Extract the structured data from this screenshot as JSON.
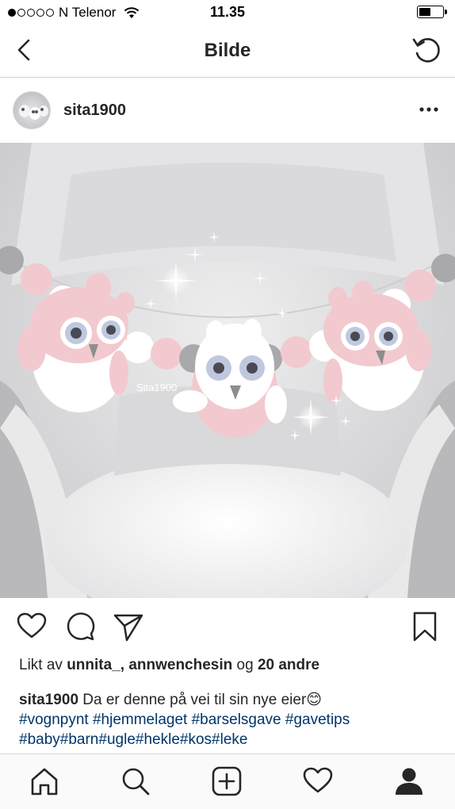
{
  "status_bar": {
    "carrier": "N Telenor",
    "time": "11.35",
    "signal_bars_filled": 1,
    "signal_bars_total": 5,
    "battery_level": 0.5
  },
  "nav": {
    "title": "Bilde",
    "back_icon": "chevron-left-icon",
    "refresh_icon": "refresh-icon"
  },
  "post": {
    "username": "sita1900",
    "more_icon": "more-horizontal-icon",
    "image_watermark": "Sita1900",
    "likes": {
      "prefix": "Likt av ",
      "user1": "unnita_",
      "separator": ", ",
      "user2": "annwenchesin",
      "middle": " og ",
      "others": "20 andre"
    },
    "caption": {
      "user": "sita1900",
      "text": " Da er denne på vei til sin nye eier😊",
      "hashtags": [
        "#vognpynt",
        "#hjemmelaget",
        "#barselsgave",
        "#gavetips",
        "#baby",
        "#barn",
        "#ugle",
        "#hekle",
        "#kos",
        "#leke"
      ]
    }
  },
  "actions": {
    "like_icon": "heart-icon",
    "comment_icon": "comment-icon",
    "share_icon": "send-icon",
    "save_icon": "bookmark-icon"
  },
  "tab_bar": {
    "items": [
      "home-icon",
      "search-icon",
      "add-icon",
      "activity-heart-icon",
      "profile-icon"
    ]
  },
  "colors": {
    "hashtag": "#003569",
    "text": "#262626",
    "divider": "#cfcfcf",
    "owl_pink": "#f2c9cf",
    "bead_grey": "#a8a8aa"
  }
}
